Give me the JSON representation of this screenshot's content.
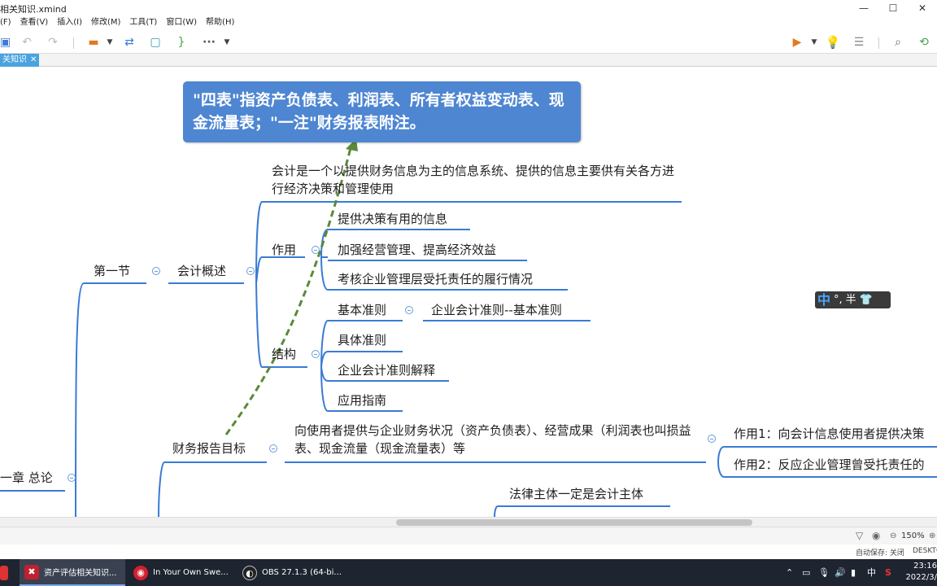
{
  "window": {
    "title": "相关知识.xmind",
    "controls": {
      "minimize": "—",
      "maximize": "☐",
      "close": "✕"
    }
  },
  "menu": [
    "(F)",
    "查看(V)",
    "插入(I)",
    "修改(M)",
    "工具(T)",
    "窗口(W)",
    "帮助(H)"
  ],
  "toolbar": {
    "icons": [
      "save-icon",
      "undo-icon",
      "redo-icon",
      "topic-style-icon",
      "dropdown-arrow-icon",
      "relationship-icon",
      "boundary-icon",
      "summary-icon",
      "more-icon",
      "dropdown-arrow-icon",
      "presentation-icon",
      "dropdown-arrow-icon",
      "idea-bulb-icon",
      "outline-icon",
      "search-icon",
      "share-icon"
    ],
    "more_label": "···"
  },
  "tab": {
    "label": "关知识",
    "close": "✕"
  },
  "callout": {
    "text": "\"四表\"指资产负债表、利润表、所有者权益变动表、现金流量表；\"一注\"财务报表附注。",
    "color": "#4e86d2"
  },
  "mindmap": {
    "root": "一章 总论",
    "section1": "第一节",
    "topic_overview": "会计概述",
    "definition": "会计是一个以提供财务信息为主的信息系统、提供的信息主要供有关各方进行经济决策和管理使用",
    "role_label": "作用",
    "roles": [
      "提供决策有用的信息",
      "加强经营管理、提高经济效益",
      "考核企业管理层受托责任的履行情况"
    ],
    "structure_label": "结构",
    "structure": [
      "基本准则",
      "具体准则",
      "企业会计准则解释",
      "应用指南"
    ],
    "basic_standard_detail": "企业会计准则--基本准则",
    "report_goal": "财务报告目标",
    "report_goal_detail": "向使用者提供与企业财务状况（资产负债表）、经营成果（利润表也叫损益表、现金流量（现金流量表）等",
    "goal_roles": [
      "作用1：向会计信息使用者提供决策",
      "作用2：反应企业管理曾受托责任的"
    ],
    "legal_entity": "法律主体一定是会计主体",
    "line_color": "#3a7bd5",
    "arrow_color": "#5a8a3a"
  },
  "ime": {
    "mode": "中",
    "punct": "°,",
    "width": "半",
    "skin": "👕"
  },
  "status": {
    "zoom": "150%",
    "zoom_minus": "⊖",
    "zoom_plus": "⊕"
  },
  "autosave": {
    "text": "自动保存: 关闭",
    "computer": "DESKTO"
  },
  "taskbar": {
    "items": [
      {
        "label": "资产评估相关知识...",
        "icon": "xmind-icon"
      },
      {
        "label": "In Your Own Swe...",
        "icon": "netease-music-icon"
      },
      {
        "label": "OBS 27.1.3 (64-bi...",
        "icon": "obs-icon"
      }
    ],
    "tray": {
      "ime": "中",
      "time": "23:16",
      "date": "2022/3/"
    }
  }
}
